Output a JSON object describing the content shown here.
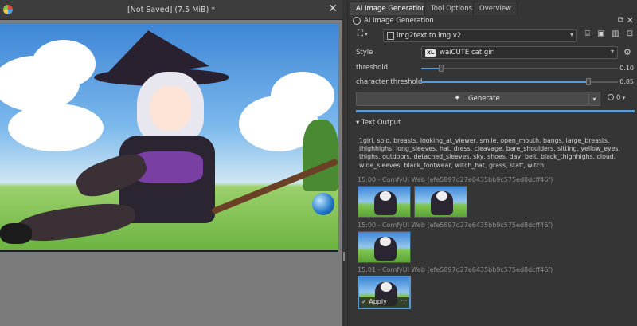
{
  "canvas": {
    "title": "[Not Saved]  (7.5 MiB) *",
    "close_label": "✕"
  },
  "docker": {
    "tabs": [
      {
        "label": "AI Image Generation",
        "active": true
      },
      {
        "label": "Tool Options",
        "active": false
      },
      {
        "label": "Overview",
        "active": false
      }
    ],
    "panel_title": "AI Image Generation",
    "float_label": "⧉",
    "close_label": "✕"
  },
  "workflow": {
    "mode_icon": "workflow-mode-icon",
    "selected": "img2text to img v2"
  },
  "style": {
    "label": "Style",
    "badge": "XL",
    "selected": "waiCUTE cat girl"
  },
  "threshold": {
    "label": "threshold",
    "value": 0.1,
    "value_text": "0.10"
  },
  "character_threshold": {
    "label": "character threshold",
    "value": 0.85,
    "value_text": "0.85"
  },
  "generate": {
    "label": "Generate",
    "queue_count": "0"
  },
  "text_output": {
    "toggle_label": "▾  Text Output",
    "content": "1girl, solo, breasts, looking_at_viewer, smile, open_mouth, bangs, large_breasts, thighhighs, long_sleeves, hat, dress, cleavage, bare_shoulders, sitting, yellow_eyes, thighs, outdoors, detached_sleeves, sky, shoes, day, belt, black_thighhighs, cloud, wide_sleeves, black_footwear, witch_hat, grass, staff, witch"
  },
  "history_groups": [
    {
      "label": "15:00 - ComfyUI Web (efe5897d27e6435bb9c575ed8dcff46f)"
    },
    {
      "label": "15:00 - ComfyUI Web (efe5897d27e6435bb9c575ed8dcff46f)"
    },
    {
      "label": "15:01 - ComfyUI Web (efe5897d27e6435bb9c575ed8dcff46f)"
    }
  ],
  "apply_label": "Apply",
  "more_label": "···",
  "colors": {
    "accent": "#5b9bd5",
    "panel_bg": "#353535",
    "canvas_bg": "#7b7b7b"
  }
}
